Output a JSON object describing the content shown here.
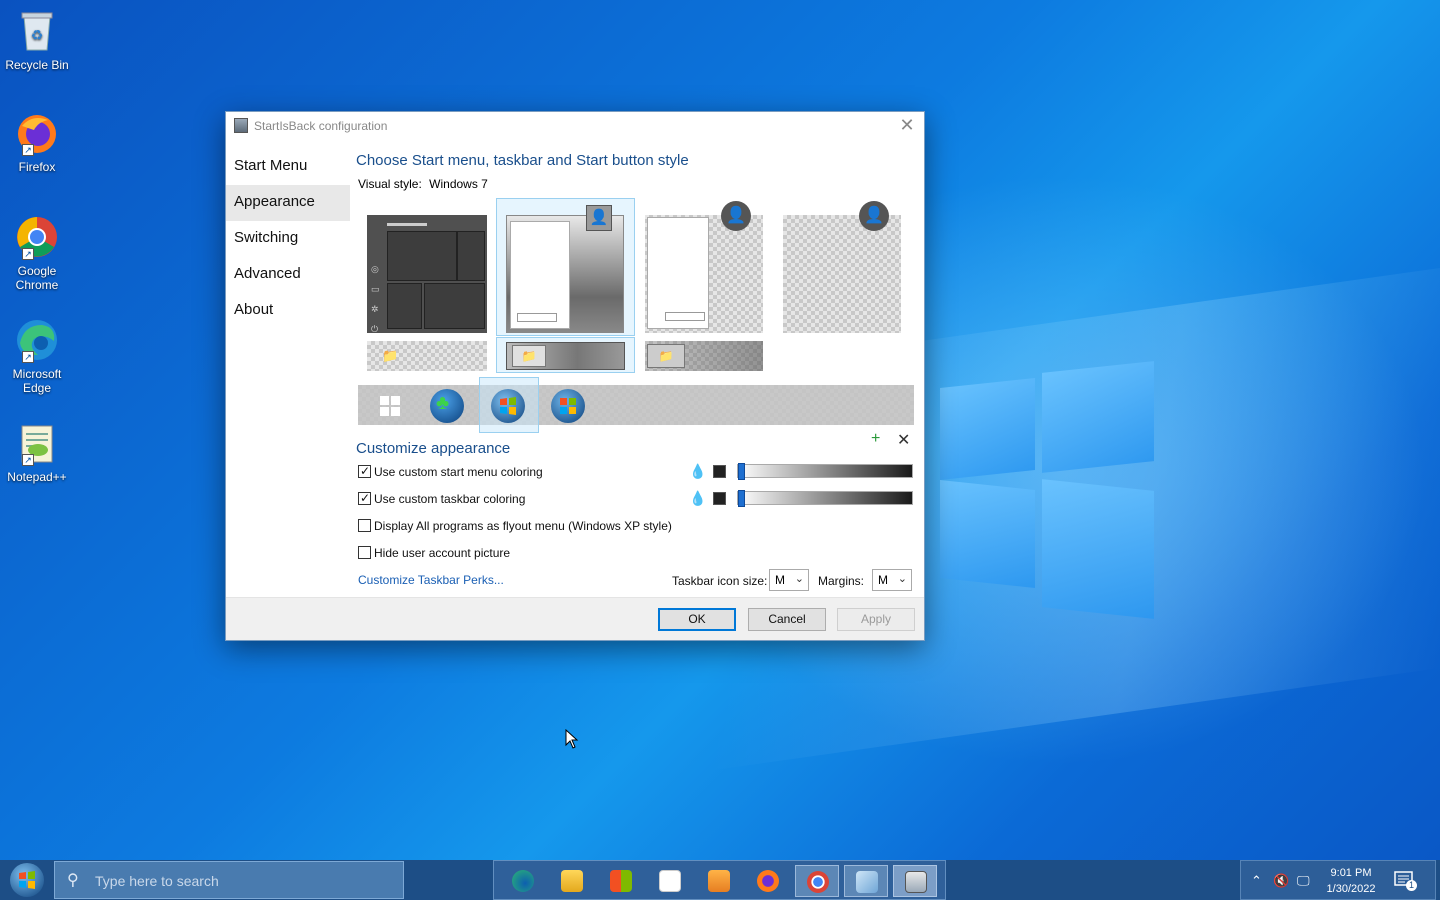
{
  "desktop": {
    "icons": [
      {
        "label": "Recycle Bin"
      },
      {
        "label": "Firefox"
      },
      {
        "label": "Google Chrome"
      },
      {
        "label": "Microsoft Edge"
      },
      {
        "label": "Notepad++"
      }
    ]
  },
  "dialog": {
    "title": "StartIsBack configuration",
    "nav": [
      {
        "label": "Start Menu"
      },
      {
        "label": "Appearance"
      },
      {
        "label": "Switching"
      },
      {
        "label": "Advanced"
      },
      {
        "label": "About"
      }
    ],
    "heading": "Choose Start menu, taskbar and Start button style",
    "visual_style_label": "Visual style:",
    "visual_style_value": "Windows 7",
    "customize_title": "Customize appearance",
    "options": [
      {
        "label": "Use custom start menu coloring",
        "checked": true
      },
      {
        "label": "Use custom taskbar coloring",
        "checked": true
      },
      {
        "label": "Display All programs as flyout menu (Windows XP style)",
        "checked": false
      },
      {
        "label": "Hide user account picture",
        "checked": false
      }
    ],
    "perks_link": "Customize Taskbar Perks...",
    "icon_size_label": "Taskbar icon size:",
    "icon_size_value": "M",
    "margins_label": "Margins:",
    "margins_value": "M",
    "ok": "OK",
    "cancel": "Cancel",
    "apply": "Apply"
  },
  "taskbar": {
    "search_placeholder": "Type here to search",
    "time": "9:01 PM",
    "date": "1/30/2022",
    "notification_count": "1"
  },
  "colors": {
    "accent": "#0078d7",
    "heading": "#1a4f8c",
    "link": "#1a5fb4"
  }
}
